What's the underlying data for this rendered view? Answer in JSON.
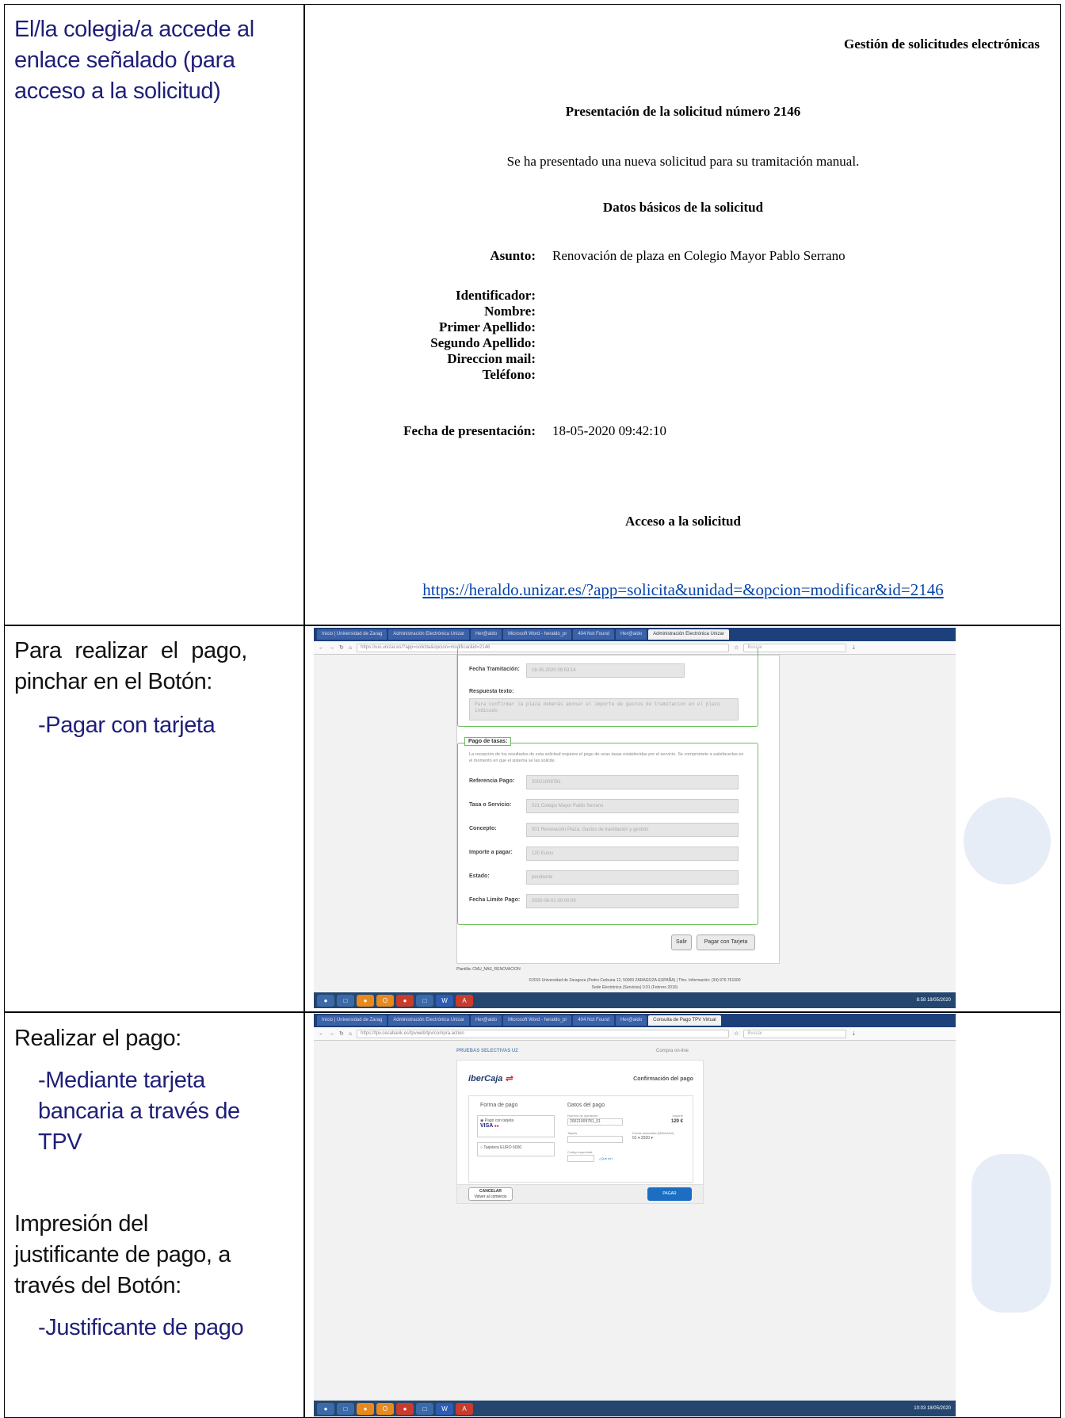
{
  "rows": [
    {
      "left_lines": [
        "El/la colegia/a accede al",
        "enlace señalado (para",
        "acceso a la solicitud)"
      ]
    },
    {
      "left_lines": [
        "Para realizar el pago,",
        "pinchar en el Botón:",
        "-Pagar con tarjeta"
      ]
    },
    {
      "left_lines": [
        "Realizar el pago:",
        "-Mediante tarjeta",
        "bancaria a través de",
        "TPV",
        "Impresión del",
        "justificante de pago, a",
        "través del Botón:",
        "-Justificante de pago"
      ]
    }
  ],
  "email": {
    "header": "Gestión de solicitudes electrónicas",
    "title": "Presentación de la solicitud número 2146",
    "message": "Se ha presentado una nueva solicitud para su tramitación manual.",
    "section": "Datos básicos de la solicitud",
    "asunto_label": "Asunto:",
    "asunto_value": "Renovación de plaza en Colegio Mayor Pablo Serrano",
    "fields": [
      "Identificador:",
      "Nombre:",
      "Primer Apellido:",
      "Segundo Apellido:",
      "Direccion mail:",
      "Teléfono:"
    ],
    "fecha_label": "Fecha de presentación:",
    "fecha_value": "18-05-2020 09:42:10",
    "acceso": "Acceso a la solicitud",
    "link": "https://heraldo.unizar.es/?app=solicita&unidad=&opcion=modificar&id=2146"
  },
  "shot1": {
    "tabs": [
      "Inicio | Universidad de Zarag",
      "Administración Electrónica Unizar",
      "Her@aldo",
      "Microsoft Word - heraldo_pr",
      "404 Not Found",
      "Her@aldo",
      "Administración Electrónica Unizar"
    ],
    "url": "https://uxi.unizar.es/?app=solicita&opcion=modificar&id=2146",
    "search": "Buscar",
    "fecha_tram_label": "Fecha Tramitación:",
    "fecha_tram_value": "18-05-2020 09:53:14",
    "respuesta_label": "Respuesta texto:",
    "respuesta_value": "Para confirmar la plaza deberás abonar el importe de gastos de tramitación en el plazo indicado",
    "pago_legend": "Pago de tasas:",
    "pago_text": "La recepción de los resultados de esta solicitud requiere el pago de unas tasas establecidas por el servicio. Se compromete a satisfacerlas en el momento en que el sistema se las solicite.",
    "pago_rows": [
      {
        "label": "Referencia Pago:",
        "value": "20021009781"
      },
      {
        "label": "Tasa o Servicio:",
        "value": "021 Colegio Mayor Pablo Serrano"
      },
      {
        "label": "Concepto:",
        "value": "001 Renovación Plaza. Gastos de tramitación y gestión"
      },
      {
        "label": "Importe a pagar:",
        "value": "120 Euros"
      },
      {
        "label": "Estado:",
        "value": "pendiente"
      },
      {
        "label": "Fecha Límite Pago:",
        "value": "2020-06-01 00:00:00"
      }
    ],
    "btn_salir": "Salir",
    "btn_pagar": "Pagar con Tarjeta",
    "plantilla": "Plantilla: CMU_NAS_RENOVACION",
    "footer1": "©2015 Universidad de Zaragoza (Pedro Cerbuna 12, 50009 ZARAGOZA-ESPAÑA) | Tfno. Información: (34) 976 761000",
    "footer2": "Sede Electrónica (Servicios) 0.01 (Febrero 2016)",
    "clock": "8:58 18/05/2020"
  },
  "shot2": {
    "tabs": [
      "Inicio | Universidad de Zarag",
      "Administración Electrónica Unizar",
      "Her@aldo",
      "Microsoft Word - heraldo_pr",
      "404 Not Found",
      "Her@aldo",
      "Consulta de Pago TPV Virtual"
    ],
    "url": "https://tpv.cecabank.es/tpvweb/tpv/compra.action",
    "search": "Buscar",
    "merchant": "PRUEBAS SELECTIVAS UZ",
    "compra": "Compra on-line",
    "bank": "iberCaja",
    "confirm": "Confirmación del pago",
    "forma": "Forma de pago",
    "datos": "Datos del pago",
    "opt1": "Pago con tarjeta",
    "opt2": "Tarjetera EURO 6000",
    "num_op_label": "Número de operación",
    "num_op": "20021009781_01",
    "importe_label": "Importe",
    "importe": "120 €",
    "tarjeta_label": "Tarjeta",
    "caducidad_label": "Fecha caducidad (MM/AAAA)",
    "mes": "01",
    "anio": "2020",
    "cvv_label": "Código seguridad",
    "que_es": "¿Qué es?",
    "cancelar": "CANCELAR",
    "volver": "Volver al comercio",
    "pagar": "PAGAR",
    "clock": "10:03 18/05/2020"
  }
}
